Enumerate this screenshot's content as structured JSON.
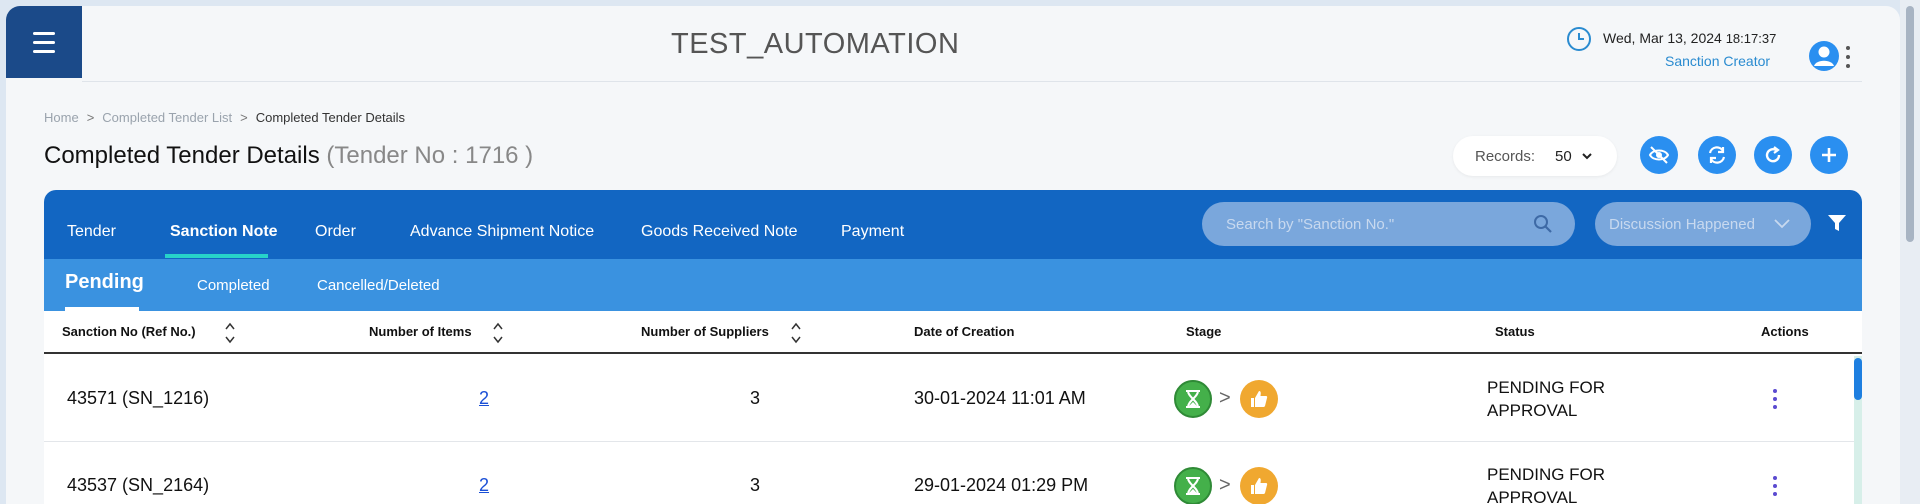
{
  "header": {
    "app_title": "TEST_AUTOMATION",
    "date": "Wed, Mar 13, 2024",
    "time": "18:17:37",
    "role": "Sanction Creator"
  },
  "breadcrumb": {
    "home": "Home",
    "sep1": ">",
    "list": "Completed Tender List",
    "sep2": ">",
    "current": "Completed Tender Details"
  },
  "page": {
    "title": "Completed Tender Details",
    "subtitle": "(Tender No : 1716 )"
  },
  "records": {
    "label": "Records:",
    "value": "50"
  },
  "tabs": [
    {
      "label": "Tender"
    },
    {
      "label": "Sanction Note"
    },
    {
      "label": "Order"
    },
    {
      "label": "Advance Shipment Notice"
    },
    {
      "label": "Goods Received Note"
    },
    {
      "label": "Payment"
    }
  ],
  "search": {
    "placeholder": "Search by \"Sanction No.\""
  },
  "discussion_filter": {
    "value": "Discussion Happened"
  },
  "subtabs": [
    {
      "label": "Pending"
    },
    {
      "label": "Completed"
    },
    {
      "label": "Cancelled/Deleted"
    }
  ],
  "table": {
    "headers": {
      "sanction_no": "Sanction No (Ref No.)",
      "items": "Number of Items",
      "suppliers": "Number of Suppliers",
      "date": "Date of Creation",
      "stage": "Stage",
      "status": "Status",
      "actions": "Actions"
    },
    "rows": [
      {
        "sanction_no": "43571 (SN_1216)",
        "items": "2",
        "suppliers": "3",
        "date": "30-01-2024 11:01 AM",
        "stage_sep": ">",
        "status": "PENDING FOR APPROVAL"
      },
      {
        "sanction_no": "43537 (SN_2164)",
        "items": "2",
        "suppliers": "3",
        "date": "29-01-2024 01:29 PM",
        "stage_sep": ">",
        "status": "PENDING FOR APPROVAL"
      }
    ]
  },
  "colors": {
    "primary": "#1266c2",
    "secondary": "#3a92e0",
    "accent": "#27d3c9",
    "stage_pending": "#44b04a",
    "stage_approve": "#f0a830"
  }
}
